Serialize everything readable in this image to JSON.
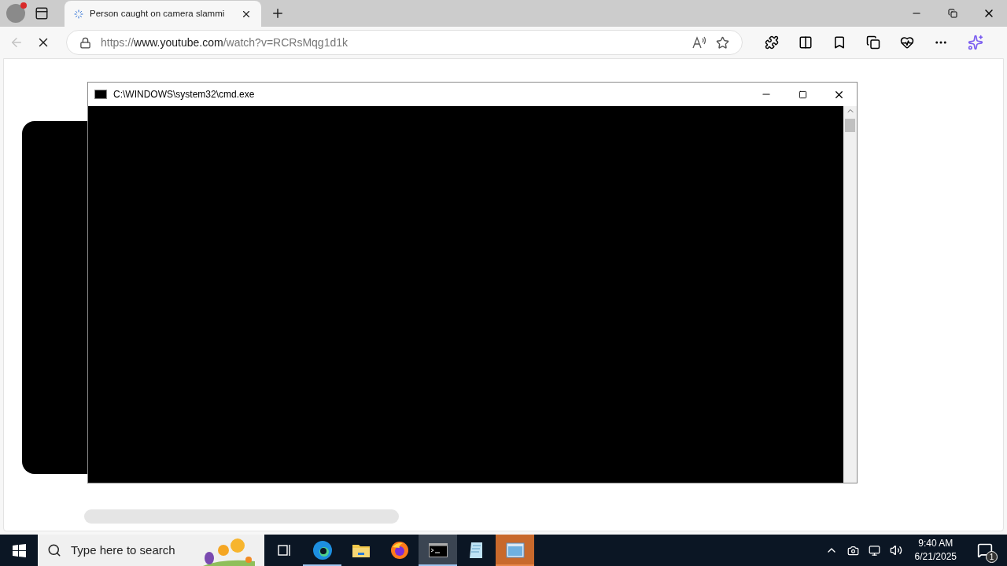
{
  "browser": {
    "tab": {
      "title": "Person caught on camera slammi",
      "loading": true,
      "selected": true
    },
    "url": {
      "scheme": "https://",
      "host": "www.youtube.com",
      "path": "/watch?v=RCRsMqg1d1k"
    }
  },
  "console_window": {
    "title": "C:\\WINDOWS\\system32\\cmd.exe"
  },
  "taskbar": {
    "search": {
      "placeholder": "Type here to search"
    },
    "apps": [
      {
        "kind": "taskview",
        "running": false,
        "selected": false,
        "flashing": false
      },
      {
        "kind": "edge",
        "running": true,
        "selected": false,
        "flashing": false
      },
      {
        "kind": "folder",
        "running": false,
        "selected": false,
        "flashing": false
      },
      {
        "kind": "firefox",
        "running": false,
        "selected": false,
        "flashing": false
      },
      {
        "kind": "console",
        "running": true,
        "selected": true,
        "flashing": false
      },
      {
        "kind": "notepad",
        "running": false,
        "selected": false,
        "flashing": false
      },
      {
        "kind": "window",
        "running": true,
        "selected": false,
        "flashing": true
      }
    ],
    "clock": {
      "time": "9:40 AM",
      "date": "6/21/2025"
    },
    "notifications": {
      "count": "1"
    }
  }
}
